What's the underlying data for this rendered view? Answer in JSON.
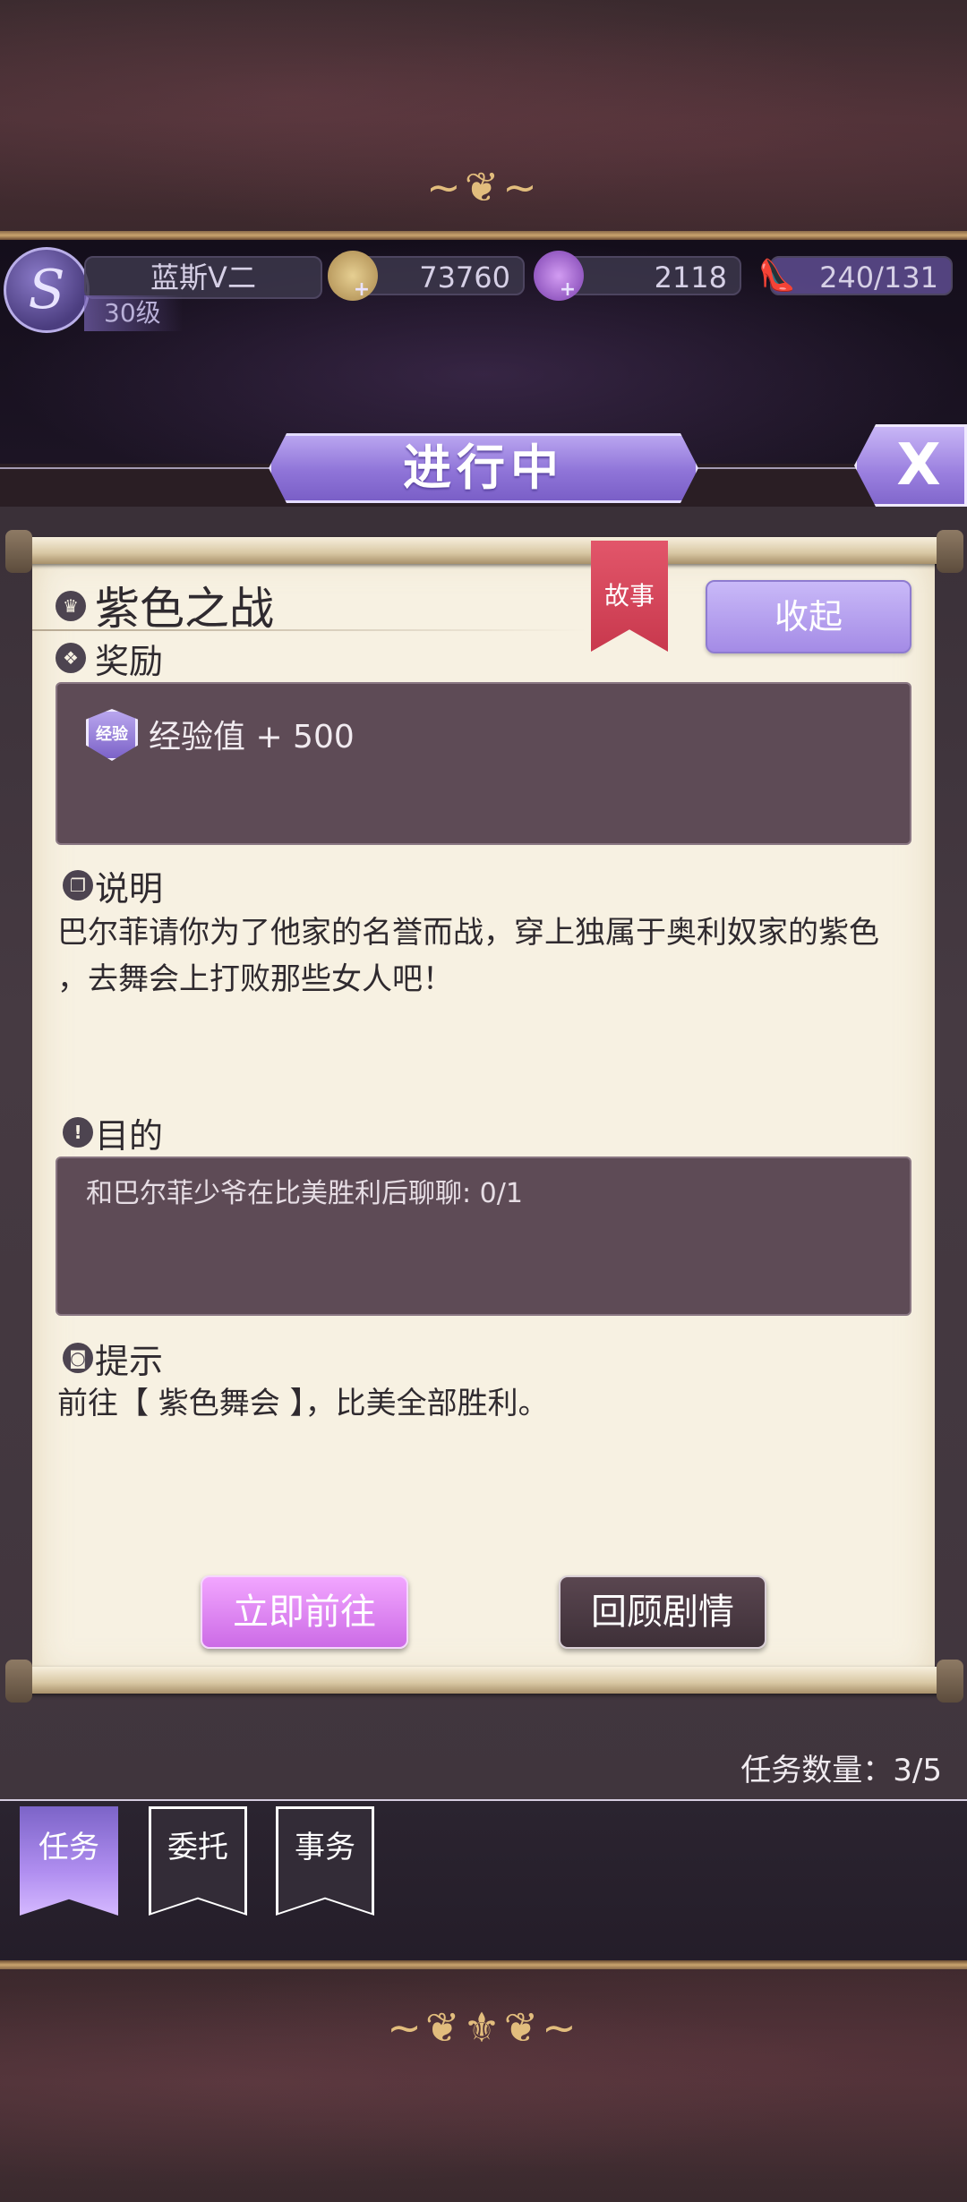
{
  "player": {
    "avatar_letter": "S",
    "name": "蓝斯V二",
    "level": "30级"
  },
  "resources": [
    {
      "name": "gold",
      "icon": "crown-coin-icon",
      "value": "73760",
      "color": "#c8a86a"
    },
    {
      "name": "gems",
      "icon": "diamond-icon",
      "value": "2118",
      "color": "#a06ad0"
    },
    {
      "name": "stamina",
      "icon": "glass-slipper-icon",
      "value": "240/131",
      "color": "#8f80c8"
    }
  ],
  "header": {
    "title": "进行中",
    "close_label": "X"
  },
  "quest": {
    "title": "紫色之战",
    "ribbon": "故事",
    "collapse_label": "收起",
    "reward": {
      "heading": "奖励",
      "badge": "经验",
      "text": "经验值 + 500"
    },
    "description": {
      "heading": "说明",
      "line1": "巴尔菲请你为了他家的名誉而战，穿上独属于奥利奴家的紫色",
      "line2": "，去舞会上打败那些女人吧！"
    },
    "goal": {
      "heading": "目的",
      "text": "和巴尔菲少爷在比美胜利后聊聊: 0/1"
    },
    "hint": {
      "heading": "提示",
      "text": "前往【 紫色舞会 】，比美全部胜利。"
    },
    "go_label": "立即前往",
    "review_label": "回顾剧情"
  },
  "task_count": "任务数量：3/5",
  "tabs": [
    {
      "label": "任务",
      "active": true
    },
    {
      "label": "委托",
      "active": false
    },
    {
      "label": "事务",
      "active": false
    }
  ],
  "colors": {
    "accent_purple": "#9a7fdf",
    "paper": "#f7f1e2",
    "ribbon_red": "#d4445a",
    "go_pink": "#d77aee"
  }
}
